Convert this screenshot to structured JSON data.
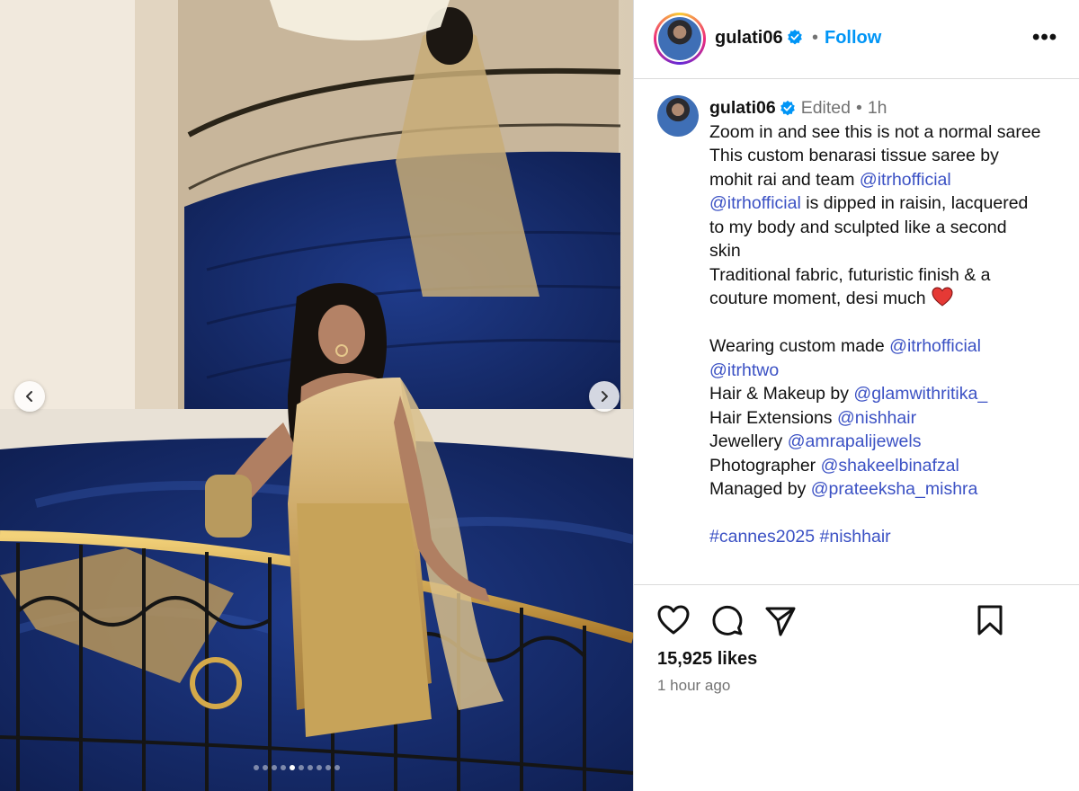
{
  "post": {
    "username": "gulati06",
    "follow_label": "Follow",
    "header_separator": "•",
    "more_label": "•••"
  },
  "caption": {
    "username": "gulati06",
    "edited_label": "Edited",
    "separator": "•",
    "time": "1h",
    "lines": [
      {
        "parts": [
          {
            "t": "Zoom in and see this is not a normal saree"
          }
        ]
      },
      {
        "parts": [
          {
            "t": "This custom benarasi tissue saree by"
          }
        ]
      },
      {
        "parts": [
          {
            "t": "mohit rai and team "
          },
          {
            "t": "@itrhofficial",
            "m": true
          }
        ]
      },
      {
        "parts": [
          {
            "t": "@itrhofficial",
            "m": true
          },
          {
            "t": " is dipped in raisin, lacquered"
          }
        ]
      },
      {
        "parts": [
          {
            "t": "to my body and sculpted like a second"
          }
        ]
      },
      {
        "parts": [
          {
            "t": "skin"
          }
        ]
      },
      {
        "parts": [
          {
            "t": "Traditional fabric, futuristic finish & a"
          }
        ]
      },
      {
        "parts": [
          {
            "t": "couture moment, desi much"
          }
        ],
        "heart": true
      },
      {
        "parts": []
      },
      {
        "parts": [
          {
            "t": "Wearing custom made "
          },
          {
            "t": "@itrhofficial",
            "m": true
          }
        ]
      },
      {
        "parts": [
          {
            "t": "@itrhtwo",
            "m": true
          }
        ]
      },
      {
        "parts": [
          {
            "t": "Hair & Makeup by "
          },
          {
            "t": "@glamwithritika_",
            "m": true
          }
        ]
      },
      {
        "parts": [
          {
            "t": "Hair Extensions "
          },
          {
            "t": "@nishhair",
            "m": true
          }
        ]
      },
      {
        "parts": [
          {
            "t": "Jewellery "
          },
          {
            "t": "@amrapalijewels",
            "m": true
          }
        ]
      },
      {
        "parts": [
          {
            "t": "Photographer "
          },
          {
            "t": "@shakeelbinafzal",
            "m": true
          }
        ]
      },
      {
        "parts": [
          {
            "t": "Managed by "
          },
          {
            "t": "@prateeksha_mishra",
            "m": true
          }
        ]
      },
      {
        "parts": []
      },
      {
        "parts": [
          {
            "t": "#cannes2025",
            "m": true
          },
          {
            "t": " "
          },
          {
            "t": "#nishhair",
            "m": true
          }
        ]
      }
    ]
  },
  "engagement": {
    "likes": "15,925 likes",
    "posted": "1 hour ago"
  },
  "carousel": {
    "total": 10,
    "active_index": 4
  },
  "colors": {
    "link": "#3b51c4",
    "follow": "#0095f6",
    "verified": "#0095f6",
    "heart": "#e53935"
  },
  "icons": {
    "like": "heart-outline-icon",
    "comment": "comment-bubble-icon",
    "share": "paper-plane-icon",
    "save": "bookmark-icon",
    "prev": "chevron-left-icon",
    "next": "chevron-right-icon"
  }
}
